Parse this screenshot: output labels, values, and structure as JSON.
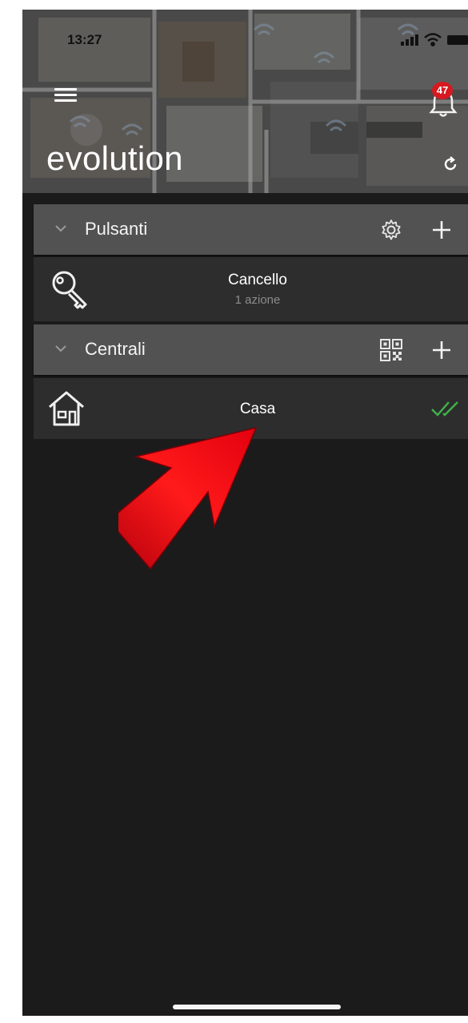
{
  "status_bar": {
    "time": "13:27"
  },
  "header": {
    "title": "evolution",
    "notification_count": "47",
    "icons": [
      "menu-icon",
      "bell-icon",
      "refresh-icon"
    ]
  },
  "sections": [
    {
      "label": "Pulsanti",
      "actions": [
        "gear-icon",
        "plus-icon"
      ],
      "items": [
        {
          "title": "Cancello",
          "subtitle": "1 azione",
          "icon": "key-icon"
        }
      ]
    },
    {
      "label": "Centrali",
      "actions": [
        "qr-code-icon",
        "plus-icon"
      ],
      "items": [
        {
          "title": "Casa",
          "icon": "house-icon",
          "status_icon": "double-check-icon",
          "status_color": "#3fb24a"
        }
      ]
    }
  ],
  "colors": {
    "background": "#1b1b1b",
    "section_header": "#525252",
    "item_row": "#2d2d2d",
    "badge": "#d71920",
    "annotation_arrow": "#e3000f"
  }
}
